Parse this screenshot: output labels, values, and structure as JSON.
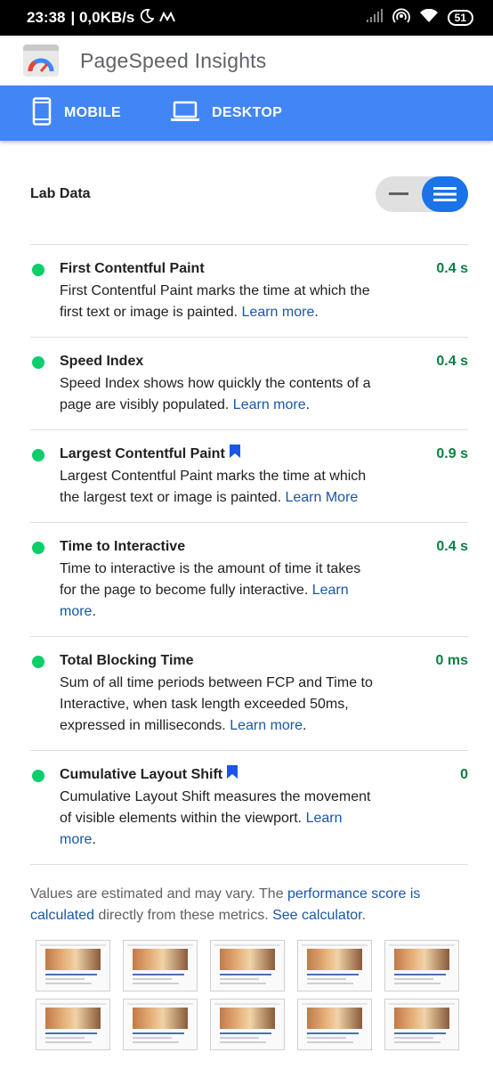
{
  "status_bar": {
    "time": "23:38",
    "network_speed": "| 0,0KB/s",
    "battery": "51",
    "icons": [
      "moon-icon",
      "m-icon",
      "signal-icon",
      "hotspot-icon",
      "wifi-icon",
      "battery-icon"
    ]
  },
  "header": {
    "title": "PageSpeed Insights",
    "logo_icon": "pagespeed-gauge-icon"
  },
  "device_tabs": [
    {
      "label": "MOBILE",
      "icon": "phone-icon"
    },
    {
      "label": "DESKTOP",
      "icon": "laptop-icon"
    }
  ],
  "lab_data": {
    "title": "Lab Data",
    "toggle_icons": [
      "collapsed-view-icon",
      "expanded-view-icon"
    ],
    "active_view": "expanded"
  },
  "metrics": [
    {
      "title": "First Contentful Paint",
      "value": "0.4 s",
      "desc": "First Contentful Paint marks the time at which the first text or image is painted. ",
      "link": "Learn more",
      "suffix": ".",
      "bookmark": false
    },
    {
      "title": "Speed Index",
      "value": "0.4 s",
      "desc": "Speed Index shows how quickly the contents of a page are visibly populated. ",
      "link": "Learn more",
      "suffix": ".",
      "bookmark": false
    },
    {
      "title": "Largest Contentful Paint",
      "value": "0.9 s",
      "desc": "Largest Contentful Paint marks the time at which the largest text or image is painted. ",
      "link": "Learn More",
      "suffix": "",
      "bookmark": true
    },
    {
      "title": "Time to Interactive",
      "value": "0.4 s",
      "desc": "Time to interactive is the amount of time it takes for the page to become fully interactive. ",
      "link": "Learn more",
      "suffix": ".",
      "bookmark": false
    },
    {
      "title": "Total Blocking Time",
      "value": "0 ms",
      "desc": "Sum of all time periods between FCP and Time to Interactive, when task length exceeded 50ms, expressed in milliseconds. ",
      "link": "Learn more",
      "suffix": ".",
      "bookmark": false
    },
    {
      "title": "Cumulative Layout Shift",
      "value": "0",
      "desc": "Cumulative Layout Shift measures the movement of visible elements within the viewport. ",
      "link": "Learn more",
      "suffix": ".",
      "bookmark": true
    }
  ],
  "footnote": {
    "text1": "Values are estimated and may vary. The ",
    "link1": "performance score is calculated",
    "text2": " directly from these metrics. ",
    "link2": "See calculator",
    "text3": "."
  },
  "thumbnails": {
    "count": 10
  },
  "colors": {
    "brand_blue": "#4285f4",
    "pass_green": "#0cce6b",
    "value_green": "#0b8043",
    "link_blue": "#1a56a8",
    "toggle_active": "#1a73e8"
  }
}
